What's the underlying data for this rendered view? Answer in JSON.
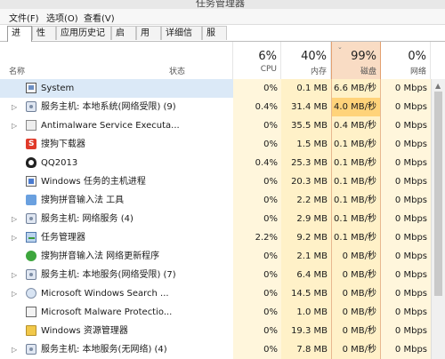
{
  "window": {
    "title": "任务管理器"
  },
  "menu": [
    "文件(F)",
    "选项(O)",
    "查看(V)"
  ],
  "tabs": [
    "进程",
    "性能",
    "应用历史记录",
    "启动",
    "用户",
    "详细信息",
    "服务"
  ],
  "header": {
    "name": "名称",
    "status": "状态",
    "cpu": {
      "pct": "6%",
      "label": "CPU"
    },
    "mem": {
      "pct": "40%",
      "label": "内存"
    },
    "disk": {
      "pct": "99%",
      "label": "磁盘"
    },
    "net": {
      "pct": "0%",
      "label": "网络"
    }
  },
  "rows": [
    {
      "expand": "",
      "icon": "system-icon",
      "name": "System",
      "cpu": "0%",
      "mem": "0.1 MB",
      "disk": "6.6 MB/秒",
      "net": "0 Mbps"
    },
    {
      "expand": "▷",
      "icon": "gear-icon",
      "name": "服务主机: 本地系统(网络受限) (9)",
      "cpu": "0.4%",
      "mem": "31.4 MB",
      "disk": "4.0 MB/秒",
      "net": "0 Mbps"
    },
    {
      "expand": "▷",
      "icon": "antimalware-icon",
      "name": "Antimalware Service Executa...",
      "cpu": "0%",
      "mem": "35.5 MB",
      "disk": "0.4 MB/秒",
      "net": "0 Mbps"
    },
    {
      "expand": "",
      "icon": "sogou-downloader-icon",
      "name": "搜狗下载器",
      "cpu": "0%",
      "mem": "1.5 MB",
      "disk": "0.1 MB/秒",
      "net": "0 Mbps"
    },
    {
      "expand": "",
      "icon": "qq-icon",
      "name": "QQ2013",
      "cpu": "0.4%",
      "mem": "25.3 MB",
      "disk": "0.1 MB/秒",
      "net": "0 Mbps"
    },
    {
      "expand": "",
      "icon": "windows-host-icon",
      "name": "Windows 任务的主机进程",
      "cpu": "0%",
      "mem": "20.3 MB",
      "disk": "0.1 MB/秒",
      "net": "0 Mbps"
    },
    {
      "expand": "",
      "icon": "sogou-input-tool-icon",
      "name": "搜狗拼音输入法 工具",
      "cpu": "0%",
      "mem": "2.2 MB",
      "disk": "0.1 MB/秒",
      "net": "0 Mbps"
    },
    {
      "expand": "▷",
      "icon": "gear-icon",
      "name": "服务主机: 网络服务 (4)",
      "cpu": "0%",
      "mem": "2.9 MB",
      "disk": "0.1 MB/秒",
      "net": "0 Mbps"
    },
    {
      "expand": "▷",
      "icon": "task-manager-icon",
      "name": "任务管理器",
      "cpu": "2.2%",
      "mem": "9.2 MB",
      "disk": "0.1 MB/秒",
      "net": "0 Mbps"
    },
    {
      "expand": "",
      "icon": "sogou-update-icon",
      "name": "搜狗拼音输入法 网络更新程序",
      "cpu": "0%",
      "mem": "2.1 MB",
      "disk": "0 MB/秒",
      "net": "0 Mbps"
    },
    {
      "expand": "▷",
      "icon": "gear-icon",
      "name": "服务主机: 本地服务(网络受限) (7)",
      "cpu": "0%",
      "mem": "6.4 MB",
      "disk": "0 MB/秒",
      "net": "0 Mbps"
    },
    {
      "expand": "▷",
      "icon": "search-icon",
      "name": "Microsoft Windows Search ...",
      "cpu": "0%",
      "mem": "14.5 MB",
      "disk": "0 MB/秒",
      "net": "0 Mbps"
    },
    {
      "expand": "",
      "icon": "malware-protection-icon",
      "name": "Microsoft Malware Protectio...",
      "cpu": "0%",
      "mem": "1.0 MB",
      "disk": "0 MB/秒",
      "net": "0 Mbps"
    },
    {
      "expand": "",
      "icon": "explorer-icon",
      "name": "Windows 资源管理器",
      "cpu": "0%",
      "mem": "19.3 MB",
      "disk": "0 MB/秒",
      "net": "0 Mbps"
    },
    {
      "expand": "▷",
      "icon": "gear-icon",
      "name": "服务主机: 本地服务(无网络) (4)",
      "cpu": "0%",
      "mem": "7.8 MB",
      "disk": "0 MB/秒",
      "net": "0 Mbps"
    }
  ],
  "colors": {
    "disk_hot": "#ffd37a",
    "heat": "#fff1c8",
    "selection": "#dbe9f7"
  }
}
